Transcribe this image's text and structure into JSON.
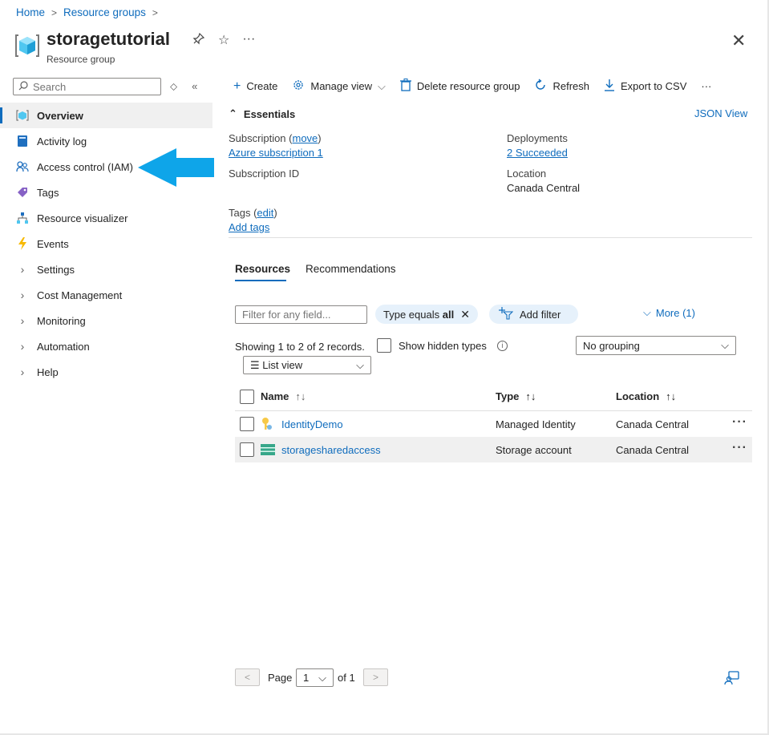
{
  "breadcrumb": {
    "home": "Home",
    "resource_groups": "Resource groups",
    "sep": ">"
  },
  "header": {
    "title": "storagetutorial",
    "subtitle": "Resource group",
    "more": "···",
    "close": "✕"
  },
  "sidebar": {
    "search_placeholder": "Search",
    "items": [
      {
        "label": "Overview",
        "icon": "resource-group-icon",
        "active": true
      },
      {
        "label": "Activity log",
        "icon": "activity-log-icon"
      },
      {
        "label": "Access control (IAM)",
        "icon": "people-icon"
      },
      {
        "label": "Tags",
        "icon": "tag-icon"
      },
      {
        "label": "Resource visualizer",
        "icon": "hierarchy-icon"
      },
      {
        "label": "Events",
        "icon": "lightning-icon"
      },
      {
        "label": "Settings",
        "expandable": true
      },
      {
        "label": "Cost Management",
        "expandable": true
      },
      {
        "label": "Monitoring",
        "expandable": true
      },
      {
        "label": "Automation",
        "expandable": true
      },
      {
        "label": "Help",
        "expandable": true
      }
    ]
  },
  "toolbar": {
    "create": "Create",
    "manage_view": "Manage view",
    "delete": "Delete resource group",
    "refresh": "Refresh",
    "export": "Export to CSV",
    "more": "···"
  },
  "essentials": {
    "title": "Essentials",
    "json_view": "JSON View",
    "subscription_label": "Subscription",
    "move": "move",
    "subscription_value": "Azure subscription 1",
    "subscription_id_label": "Subscription ID",
    "deployments_label": "Deployments",
    "deployments_value": "2 Succeeded",
    "location_label": "Location",
    "location_value": "Canada Central",
    "tags_label": "Tags",
    "edit": "edit",
    "add_tags": "Add tags"
  },
  "tabs": {
    "resources": "Resources",
    "recommendations": "Recommendations"
  },
  "filters": {
    "placeholder": "Filter for any field...",
    "type_pill_prefix": "Type equals",
    "type_pill_value": "all",
    "add_filter": "Add filter",
    "more": "More (1)",
    "records": "Showing 1 to 2 of 2 records.",
    "show_hidden": "Show hidden types",
    "grouping": "No grouping",
    "list_view": "List view"
  },
  "table": {
    "headers": {
      "name": "Name",
      "type": "Type",
      "location": "Location"
    },
    "rows": [
      {
        "name": "IdentityDemo",
        "type": "Managed Identity",
        "location": "Canada Central",
        "icon": "managed-identity-icon"
      },
      {
        "name": "storagesharedaccess",
        "type": "Storage account",
        "location": "Canada Central",
        "icon": "storage-account-icon"
      }
    ]
  },
  "pager": {
    "prev": "<",
    "next": ">",
    "page_label": "Page",
    "page_value": "1",
    "of": "of 1"
  },
  "colors": {
    "accent": "#0f6cbd",
    "arrow": "#0ea5e9"
  }
}
